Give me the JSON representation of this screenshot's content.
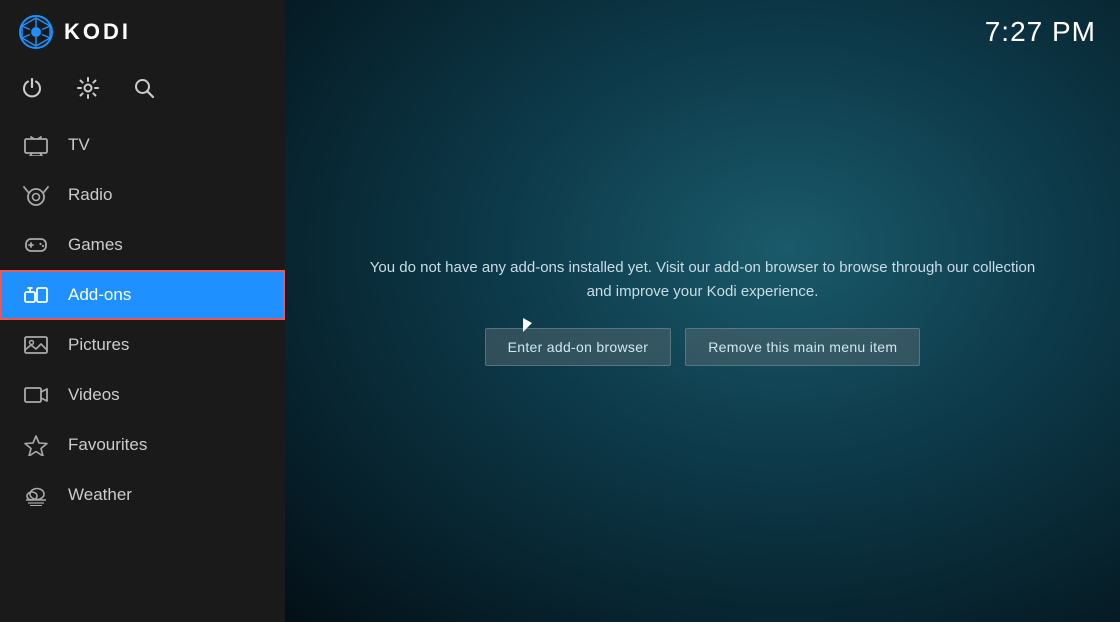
{
  "header": {
    "app_name": "KODI",
    "clock": "7:27 PM"
  },
  "sidebar": {
    "icons": [
      {
        "name": "power-icon",
        "symbol": "⏻",
        "label": "Power"
      },
      {
        "name": "settings-icon",
        "symbol": "⚙",
        "label": "Settings"
      },
      {
        "name": "search-icon",
        "symbol": "🔍",
        "label": "Search"
      }
    ],
    "menu_items": [
      {
        "id": "tv",
        "label": "TV",
        "icon": "tv-icon"
      },
      {
        "id": "radio",
        "label": "Radio",
        "icon": "radio-icon"
      },
      {
        "id": "games",
        "label": "Games",
        "icon": "games-icon"
      },
      {
        "id": "addons",
        "label": "Add-ons",
        "icon": "addons-icon",
        "active": true
      },
      {
        "id": "pictures",
        "label": "Pictures",
        "icon": "pictures-icon"
      },
      {
        "id": "videos",
        "label": "Videos",
        "icon": "videos-icon"
      },
      {
        "id": "favourites",
        "label": "Favourites",
        "icon": "favourites-icon"
      },
      {
        "id": "weather",
        "label": "Weather",
        "icon": "weather-icon"
      }
    ]
  },
  "main": {
    "info_text": "You do not have any add-ons installed yet. Visit our add-on browser to browse through our collection and improve your Kodi experience.",
    "buttons": [
      {
        "id": "enter-addon-browser",
        "label": "Enter add-on browser"
      },
      {
        "id": "remove-menu-item",
        "label": "Remove this main menu item"
      }
    ]
  }
}
